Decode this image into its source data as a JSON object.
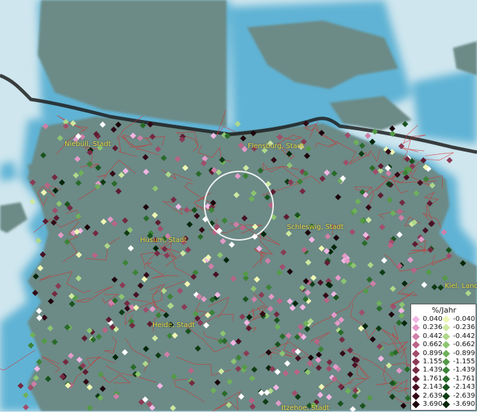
{
  "map": {
    "cities": [
      {
        "label": "Niebüll, Stadt"
      },
      {
        "label": "Flensburg, Stadt"
      },
      {
        "label": "Schleswig, Stadt"
      },
      {
        "label": "Husum, Stadt"
      },
      {
        "label": "Kiel, Land"
      },
      {
        "label": "Heide, Stadt"
      },
      {
        "label": "Itzehoe, Stadt"
      }
    ],
    "colors": {
      "water": "#cfe6ee",
      "land": "#6c8a86",
      "border": "#1e1e1e",
      "admin_lines": "#d92b2b",
      "highlight_circle": "#ffffff"
    },
    "marker_shape": "diamond"
  },
  "legend": {
    "title": "%/Jahr",
    "positive": [
      {
        "label": "0.040",
        "color": "#f2b6e4"
      },
      {
        "label": "0.236",
        "color": "#e39ac9"
      },
      {
        "label": "0.442",
        "color": "#cf7fa8"
      },
      {
        "label": "0.662",
        "color": "#b96487"
      },
      {
        "label": "0.899",
        "color": "#a04e6b"
      },
      {
        "label": "1.155",
        "color": "#8a3b55"
      },
      {
        "label": "1.439",
        "color": "#742a42"
      },
      {
        "label": "1.761",
        "color": "#5e1c31"
      },
      {
        "label": "2.143",
        "color": "#481123"
      },
      {
        "label": "2.639",
        "color": "#320916"
      },
      {
        "label": "3.690",
        "color": "#1c030b"
      }
    ],
    "negative": [
      {
        "label": "-0.040",
        "color": "#eef7b4"
      },
      {
        "label": "-0.236",
        "color": "#cde9a0"
      },
      {
        "label": "-0.442",
        "color": "#aed88a"
      },
      {
        "label": "-0.662",
        "color": "#8dc572"
      },
      {
        "label": "-0.899",
        "color": "#6fb05b"
      },
      {
        "label": "-1.155",
        "color": "#549a47"
      },
      {
        "label": "-1.439",
        "color": "#3c8337"
      },
      {
        "label": "-1.761",
        "color": "#296b2a"
      },
      {
        "label": "-2.143",
        "color": "#1a531e"
      },
      {
        "label": "-2.639",
        "color": "#0f3c14"
      },
      {
        "label": "-3.690",
        "color": "#06260b"
      }
    ]
  }
}
